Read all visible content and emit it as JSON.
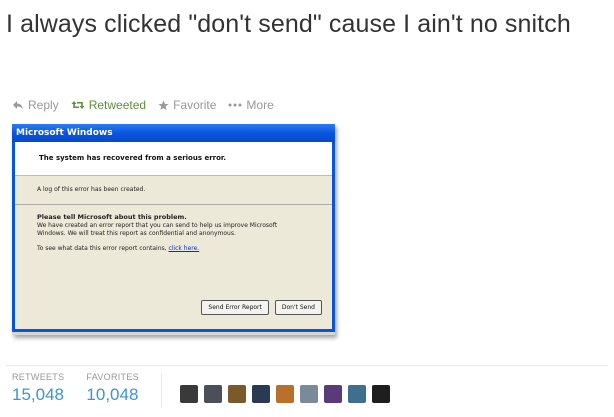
{
  "tweet": {
    "text": "I always clicked \"don't send\" cause I ain't no snitch"
  },
  "actions": {
    "reply": "Reply",
    "retweet": "Retweeted",
    "favorite": "Favorite",
    "more": "More"
  },
  "dialog": {
    "title": "Microsoft Windows",
    "heading": "The system has recovered from a serious error.",
    "log_text": "A log of this error has been created.",
    "prompt": "Please tell Microsoft about this problem.",
    "description": "We have created an error report that you can send to help us improve Microsoft Windows. We will treat this report as confidential and anonymous.",
    "see_prefix": "To see what data this error report contains,",
    "see_link": "click here.",
    "send_button": "Send Error Report",
    "dont_send_button": "Don't Send"
  },
  "stats": {
    "retweets_label": "RETWEETS",
    "retweets_value": "15,048",
    "favorites_label": "FAVORITES",
    "favorites_value": "10,048"
  },
  "colors": {
    "link_blue": "#3b94d9",
    "retweet_green": "#5c913b",
    "muted_gray": "#999999",
    "xp_title_blue": "#0a56e0"
  },
  "avatars": [
    {
      "color": "#3a3a3a",
      "icon": "avatar"
    },
    {
      "color": "#4a4f5a",
      "icon": "avatar"
    },
    {
      "color": "#7a5a2a",
      "icon": "avatar"
    },
    {
      "color": "#2a3a55",
      "icon": "avatar"
    },
    {
      "color": "#b8702a",
      "icon": "avatar"
    },
    {
      "color": "#7a8a9a",
      "icon": "avatar"
    },
    {
      "color": "#5a3a7a",
      "icon": "avatar"
    },
    {
      "color": "#3f6f8f",
      "icon": "avatar"
    },
    {
      "color": "#1e1e1e",
      "icon": "avatar"
    }
  ]
}
